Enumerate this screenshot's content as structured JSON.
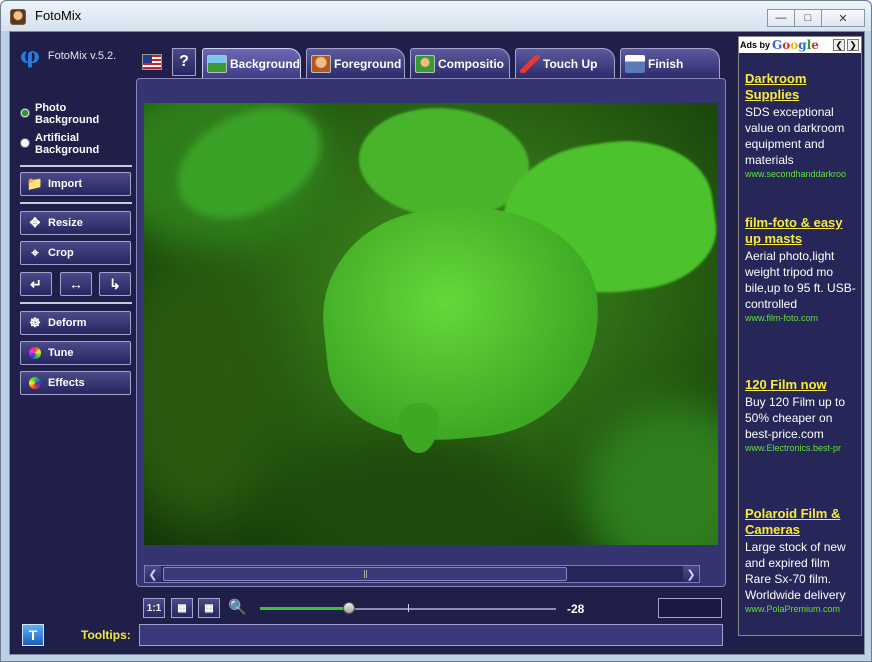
{
  "window": {
    "title": "FotoMix",
    "controls": [
      "minimize",
      "maximize",
      "close"
    ]
  },
  "app": {
    "version": "FotoMix v.5.2."
  },
  "tabs": [
    {
      "label": "Background",
      "active": true
    },
    {
      "label": "Foreground",
      "active": false
    },
    {
      "label": "Compositio",
      "active": false
    },
    {
      "label": "Touch Up",
      "active": false
    },
    {
      "label": "Finish",
      "active": false
    }
  ],
  "background_type": {
    "options": [
      {
        "line1": "Photo",
        "line2": "Background",
        "selected": true
      },
      {
        "line1": "Artificial",
        "line2": "Background",
        "selected": false
      }
    ]
  },
  "tools": {
    "import": "Import",
    "resize": "Resize",
    "crop": "Crop",
    "deform": "Deform",
    "tune": "Tune",
    "effects": "Effects"
  },
  "view": {
    "zoom_value": "-28",
    "zoom_level": 0.3,
    "one_to_one": "1:1"
  },
  "status": {
    "tooltips_label": "Tooltips:",
    "tooltips_text": ""
  },
  "ads": {
    "ads_by": "Ads by",
    "google": "Google",
    "items": [
      {
        "title": "Darkroom Supplies",
        "desc": "SDS exceptional value on darkroom equipment and materials",
        "url": "www.secondhanddarkroo"
      },
      {
        "title": "film-foto & easy up masts",
        "desc": "Aerial photo,light weight tripod mo bile,up to 95 ft. USB-controlled",
        "url": "www.film-foto.com"
      },
      {
        "title": "120 Film now",
        "desc": "Buy 120 Film up to 50% cheaper on best-price.com",
        "url": "www.Electronics.best-pr"
      },
      {
        "title": "Polaroid Film & Cameras",
        "desc": "Large stock of new and expired film Rare Sx-70 film. Worldwide delivery",
        "url": "www.PolaPremium.com"
      }
    ]
  }
}
